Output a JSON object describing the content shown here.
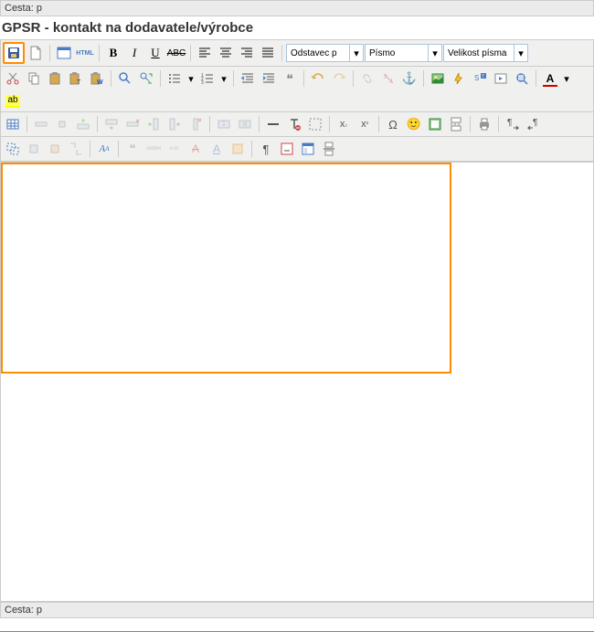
{
  "path1": "Cesta: p",
  "title": "GPSR - kontakt na dodavatele/výrobce",
  "selects": {
    "format": "Odstavec p",
    "font": "Písmo",
    "size": "Velikost písma"
  },
  "text": {
    "b": "B",
    "i": "I",
    "u": "U",
    "s": "ABC",
    "html": "HTML",
    "sub": "x",
    "sup": "x",
    "omega": "Ω",
    "smile": "🙂",
    "para": "¶",
    "aa": "A",
    "abbr": "ABBR",
    "as": "A.B.",
    "quote": "❝",
    "anchor": "⚓"
  },
  "path2": "Cesta: p"
}
